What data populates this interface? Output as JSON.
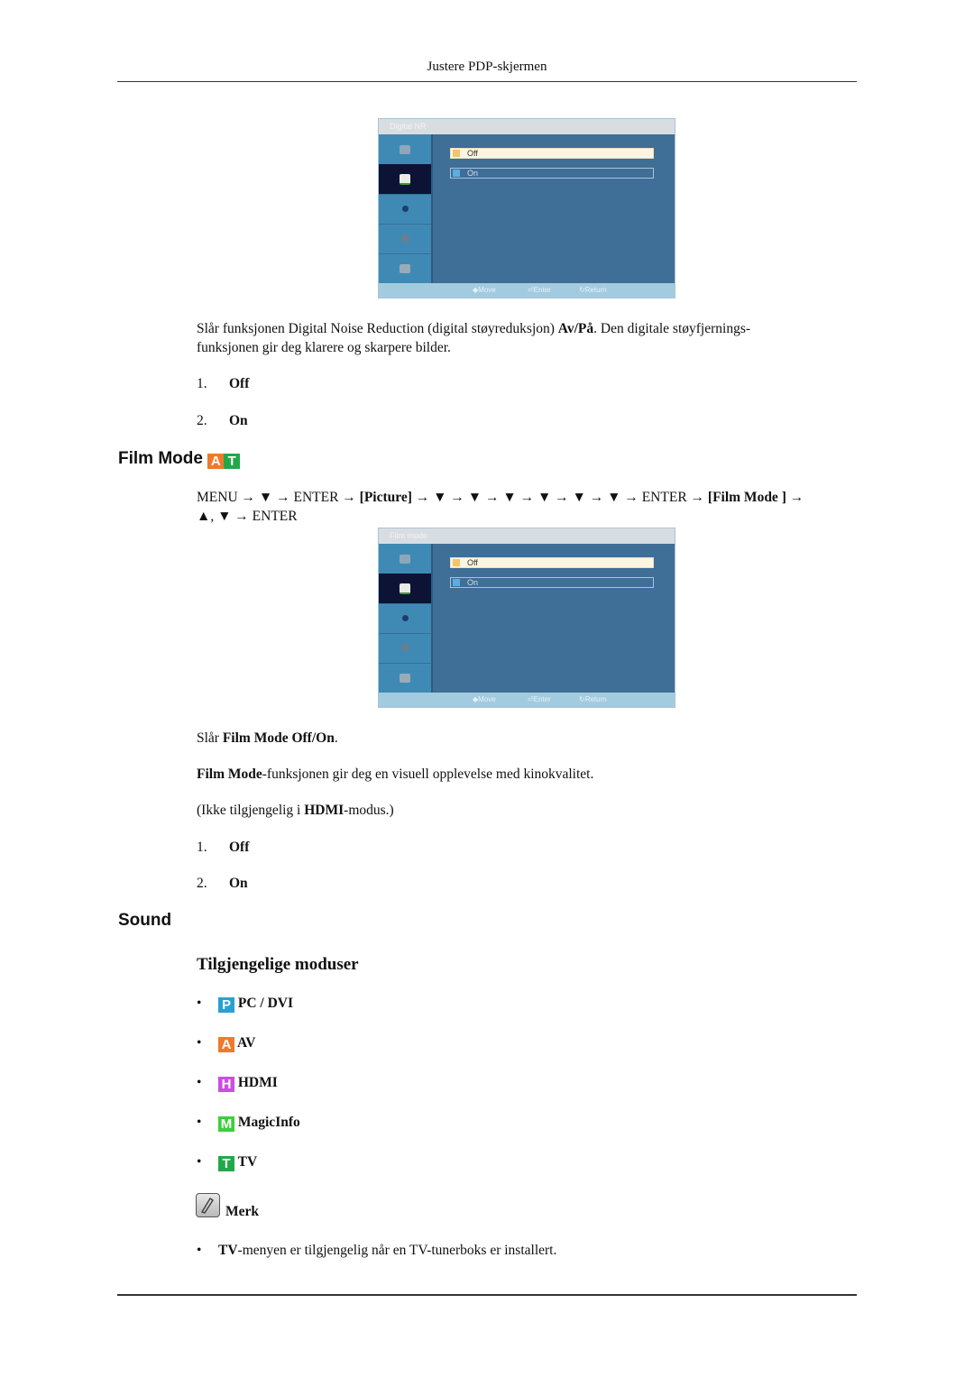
{
  "page": {
    "header": "Justere PDP-skjermen"
  },
  "digital_nr": {
    "osd": {
      "title": "Digital NR",
      "options": [
        "Off",
        "On"
      ],
      "selected": "Off",
      "footer": {
        "move": "Move",
        "enter": "Enter",
        "return": "Return"
      }
    },
    "desc_pre": "Slår funksjonen Digital Noise Reduction (digital støyreduksjon) ",
    "desc_bold": "Av/På",
    "desc_post": ". Den digitale støyfjernings-",
    "desc_line2": "funksjonen gir deg klarere og skarpere bilder.",
    "list": [
      {
        "num": "1.",
        "label": "Off"
      },
      {
        "num": "2.",
        "label": "On"
      }
    ]
  },
  "film_mode": {
    "heading": "Film Mode",
    "badges": [
      {
        "letter": "A",
        "color": "#f07a2a"
      },
      {
        "letter": "T",
        "color": "#22a84a"
      }
    ],
    "nav_line1": {
      "p1": "MENU → ▼ → ENTER → ",
      "b1": "[Picture]",
      "p2": " → ▼ → ▼ → ▼ → ▼ → ▼ → ▼ → ENTER → ",
      "b2": "[Film Mode ]",
      "p3": " →"
    },
    "nav_line2": "▲, ▼ → ENTER",
    "osd": {
      "title": "Film mode",
      "options": [
        "Off",
        "On"
      ],
      "selected": "Off",
      "footer": {
        "move": "Move",
        "enter": "Enter",
        "return": "Return"
      }
    },
    "p1_pre": "Slår ",
    "p1_bold": "Film Mode Off/On",
    "p1_post": ".",
    "p2_bold": "Film Mode",
    "p2_post": "-funksjonen gir deg en visuell opplevelse med kinokvalitet.",
    "p3_pre": "(Ikke tilgjengelig i ",
    "p3_bold": "HDMI",
    "p3_post": "-modus.)",
    "list": [
      {
        "num": "1.",
        "label": "Off"
      },
      {
        "num": "2.",
        "label": "On"
      }
    ]
  },
  "sound": {
    "heading": "Sound",
    "subheading": "Tilgjengelige moduser",
    "modes": [
      {
        "bullet": "•",
        "letter": "P",
        "color": "#2a9fd2",
        "label": "PC / DVI"
      },
      {
        "bullet": "•",
        "letter": "A",
        "color": "#f07a2a",
        "label": "AV"
      },
      {
        "bullet": "•",
        "letter": "H",
        "color": "#c94fe0",
        "label": "HDMI"
      },
      {
        "bullet": "•",
        "letter": "M",
        "color": "#3ccf3c",
        "label": "MagicInfo"
      },
      {
        "bullet": "•",
        "letter": "T",
        "color": "#22a84a",
        "label": "TV"
      }
    ],
    "note_label": "Merk",
    "note_bullet": "•",
    "note_bold": "TV",
    "note_text": "-menyen er tilgjengelig når en TV-tunerboks er installert."
  }
}
